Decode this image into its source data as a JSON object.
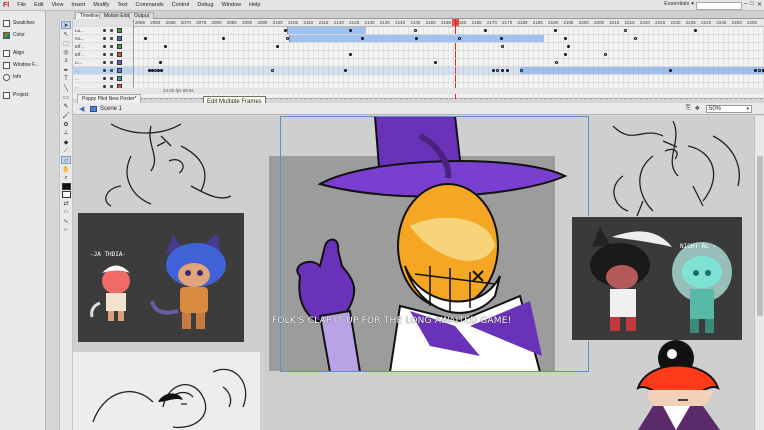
{
  "app": {
    "logo": "Fl",
    "menus": [
      "File",
      "Edit",
      "View",
      "Insert",
      "Modify",
      "Text",
      "Commands",
      "Control",
      "Debug",
      "Window",
      "Help"
    ],
    "workspace": "Essentials",
    "window_controls": [
      "–",
      "□",
      "✕"
    ]
  },
  "panels": [
    {
      "label": "Swatches",
      "icon": "swatches-icon"
    },
    {
      "label": "Color",
      "icon": "color-icon"
    },
    {
      "label": "Align",
      "icon": "align-icon"
    },
    {
      "label": "Window F...",
      "icon": "window-icon"
    },
    {
      "label": "Info",
      "icon": "info-icon"
    },
    {
      "label": "Project",
      "icon": "project-icon"
    }
  ],
  "timeline": {
    "tabs": [
      "Timeline",
      "Motion Editor",
      "Output"
    ],
    "ruler": [
      "2055",
      "2060",
      "2065",
      "2070",
      "2075",
      "2080",
      "2085",
      "2090",
      "2095",
      "2100",
      "2105",
      "2110",
      "2115",
      "2120",
      "2125",
      "2130",
      "2135",
      "2140",
      "2145",
      "2150",
      "2155",
      "2160",
      "2165",
      "2170",
      "2175",
      "2180",
      "2185",
      "2190",
      "2195",
      "2200",
      "2205",
      "2210",
      "2215",
      "2220",
      "2225",
      "2230",
      "2235",
      "2240",
      "2245",
      "2250",
      "2255"
    ],
    "layers": [
      {
        "name": "La...",
        "color": "#4a9a4a"
      },
      {
        "name": "Ka...",
        "color": "#3f6ed6"
      },
      {
        "name": "Eff...",
        "color": "#4a9a4a"
      },
      {
        "name": "Eff...",
        "color": "#d44f4f"
      },
      {
        "name": "Li...",
        "color": "#7a4fd1"
      },
      {
        "name": "...",
        "color": "#4f7ad1",
        "selected": true
      },
      {
        "name": "...",
        "color": "#3aa0a0"
      },
      {
        "name": "...",
        "color": "#d44f4f"
      }
    ],
    "current_frame": "2158",
    "status": "24.00 fps   89.5s"
  },
  "tooltip": "Edit Multiple Frames",
  "document": {
    "tab": "Poppy Pilot New Poster*",
    "scene": "Scene 1",
    "zoom": "50%"
  },
  "stage": {
    "subtitle": "FOLK'S CLAP IT UP FOR THE LONG AWAITED GAME!",
    "labels": [
      "-JA THDIA-",
      "NIGHT AL -"
    ]
  },
  "colors": {
    "selection": "#5c96e2",
    "playhead": "#e0231b",
    "hat_purple": "#6a32b8",
    "face_orange": "#f5a623"
  }
}
